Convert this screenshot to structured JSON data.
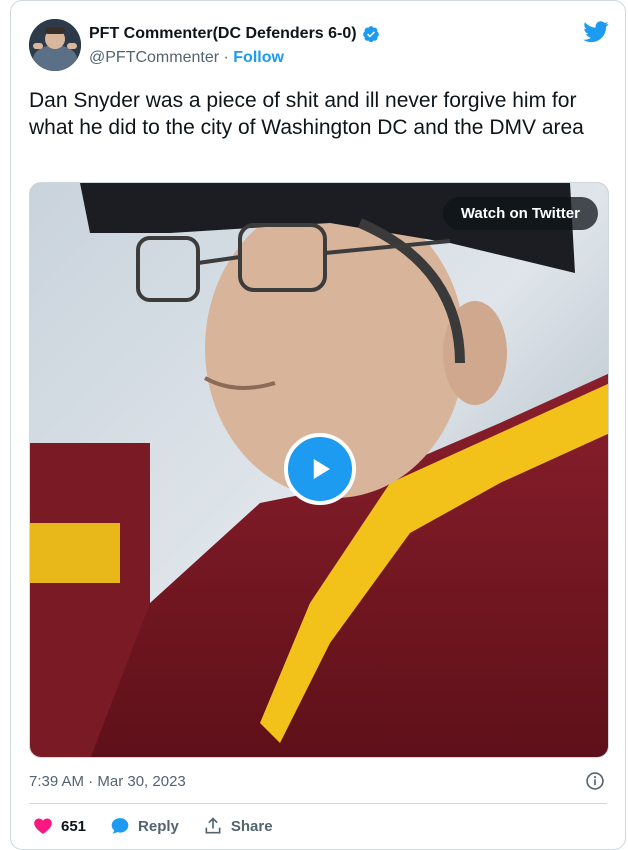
{
  "author": {
    "name": "PFT Commenter(DC Defenders 6-0)",
    "handle": "@PFTCommenter",
    "separator": " · ",
    "follow_label": "Follow"
  },
  "tweet": {
    "text": "Dan Snyder was a piece of shit and ill never forgive him for what he did to the city of Washington DC and the DMV area",
    "timestamp": "7:39 AM · Mar 30, 2023"
  },
  "media": {
    "watch_label": "Watch on Twitter"
  },
  "actions": {
    "like_count": "651",
    "reply_label": "Reply",
    "share_label": "Share"
  },
  "colors": {
    "accent": "#1d9bf0",
    "like": "#f91880",
    "text": "#0f1419",
    "muted": "#536471"
  }
}
